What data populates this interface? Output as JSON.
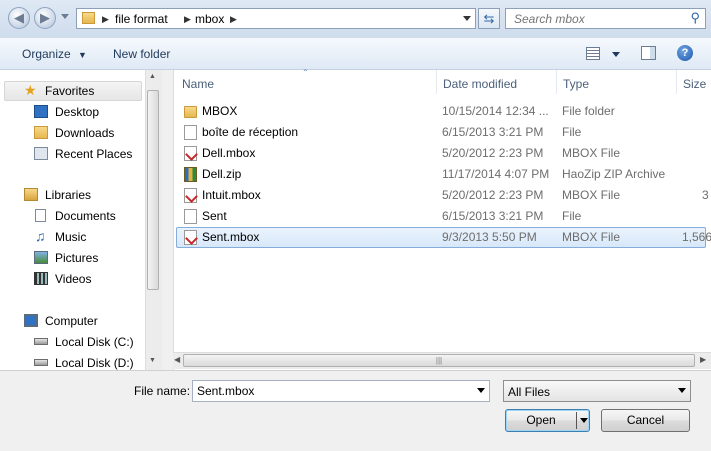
{
  "address": {
    "breadcrumbs": [
      "file format",
      "mbox"
    ],
    "search_placeholder": "Search mbox"
  },
  "toolbar": {
    "organize_label": "Organize",
    "new_folder_label": "New folder"
  },
  "nav": {
    "favorites_label": "Favorites",
    "favorites": [
      "Desktop",
      "Downloads",
      "Recent Places"
    ],
    "libraries_label": "Libraries",
    "libraries": [
      "Documents",
      "Music",
      "Pictures",
      "Videos"
    ],
    "computer_label": "Computer",
    "drives": [
      "Local Disk (C:)",
      "Local Disk (D:)"
    ]
  },
  "columns": {
    "name": "Name",
    "date": "Date modified",
    "type": "Type",
    "size": "Size"
  },
  "files": [
    {
      "name": "MBOX",
      "date": "10/15/2014 12:34 ...",
      "type": "File folder",
      "size": "",
      "icon": "folder-icon"
    },
    {
      "name": "boîte de réception",
      "date": "6/15/2013 3:21 PM",
      "type": "File",
      "size": "",
      "icon": "document-icon"
    },
    {
      "name": "Dell.mbox",
      "date": "5/20/2012 2:23 PM",
      "type": "MBOX File",
      "size": "",
      "icon": "mbox-file-icon"
    },
    {
      "name": "Dell.zip",
      "date": "11/17/2014 4:07 PM",
      "type": "HaoZip ZIP Archive",
      "size": "",
      "icon": "zip-archive-icon"
    },
    {
      "name": "Intuit.mbox",
      "date": "5/20/2012 2:23 PM",
      "type": "MBOX File",
      "size": "3",
      "icon": "mbox-file-icon"
    },
    {
      "name": "Sent",
      "date": "6/15/2013 3:21 PM",
      "type": "File",
      "size": "",
      "icon": "document-icon"
    },
    {
      "name": "Sent.mbox",
      "date": "9/3/2013 5:50 PM",
      "type": "MBOX File",
      "size": "1,566",
      "icon": "mbox-file-icon",
      "selected": true
    }
  ],
  "bottom": {
    "filename_label": "File name:",
    "filename_value": "Sent.mbox",
    "filetype_value": "All Files",
    "open_label": "Open",
    "cancel_label": "Cancel"
  }
}
